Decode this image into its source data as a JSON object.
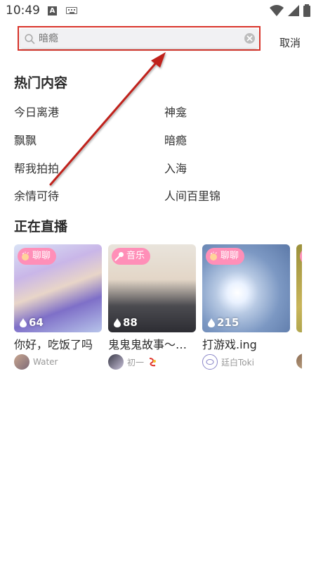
{
  "status_bar": {
    "time": "10:49"
  },
  "search": {
    "placeholder": "暗瘾",
    "cancel_label": "取消"
  },
  "hot": {
    "title": "热门内容",
    "items": [
      "今日离港",
      "神龛",
      "飘飘",
      "暗瘾",
      "帮我拍拍",
      "入海",
      "余情可待",
      "人间百里锦"
    ]
  },
  "live": {
    "title": "正在直播",
    "cards": [
      {
        "tag": "聊聊",
        "tag_icon": "clap-icon",
        "count": "64",
        "title": "你好，吃饭了吗",
        "user": "Water"
      },
      {
        "tag": "音乐",
        "tag_icon": "microphone-icon",
        "count": "88",
        "title": "鬼鬼鬼故事～…",
        "user": "初一"
      },
      {
        "tag": "聊聊",
        "tag_icon": "clap-icon",
        "count": "215",
        "title": "打游戏.ing",
        "user": "廷白Toki"
      }
    ]
  },
  "colors": {
    "annotation_red": "#d9342b",
    "tag_pink": "#ff8fb8"
  }
}
